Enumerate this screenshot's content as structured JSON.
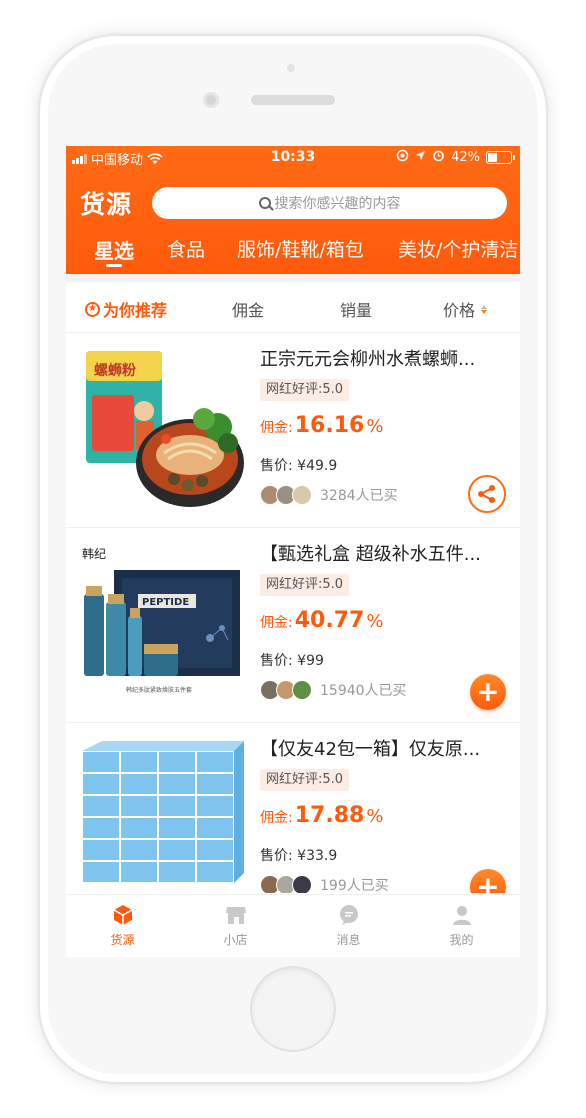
{
  "status_bar": {
    "carrier": "中国移动",
    "time": "10:33",
    "battery": "42%"
  },
  "header": {
    "title": "货源",
    "search_placeholder": "搜索你感兴趣的内容"
  },
  "categories": [
    "星选",
    "食品",
    "服饰/鞋靴/箱包",
    "美妆/个护清洁"
  ],
  "sort": {
    "recommend": "为你推荐",
    "commission": "佣金",
    "sales": "销量",
    "price": "价格"
  },
  "products": [
    {
      "title": "正宗元元会柳州水煮螺蛳...",
      "rating": "网红好评:5.0",
      "commission_label": "佣金:",
      "commission_value": "16.16",
      "commission_unit": "%",
      "price": "售价: ¥49.9",
      "buyers": "3284人已买",
      "action": "share-icon",
      "image_logo": "螺蛳粉"
    },
    {
      "title": "【甄选礼盒 超级补水五件...",
      "rating": "网红好评:5.0",
      "commission_label": "佣金:",
      "commission_value": "40.77",
      "commission_unit": "%",
      "price": "售价: ¥99",
      "buyers": "15940人已买",
      "action": "plus-icon",
      "image_brand": "韩纪",
      "image_box_text": "PEPTIDE",
      "image_caption": "韩纪多肽紧致焕肤五件套"
    },
    {
      "title": "【仅友42包一箱】仅友原...",
      "rating": "网红好评:5.0",
      "commission_label": "佣金:",
      "commission_value": "17.88",
      "commission_unit": "%",
      "price": "售价: ¥33.9",
      "buyers": "199人已买",
      "action": "plus-icon"
    }
  ],
  "tab_bar": [
    {
      "label": "货源",
      "icon": "box-icon",
      "active": true
    },
    {
      "label": "小店",
      "icon": "store-icon",
      "active": false
    },
    {
      "label": "消息",
      "icon": "message-icon",
      "active": false
    },
    {
      "label": "我的",
      "icon": "user-icon",
      "active": false
    }
  ],
  "colors": {
    "brand": "#ff5a0c",
    "header_bg": "#ff6a14"
  }
}
